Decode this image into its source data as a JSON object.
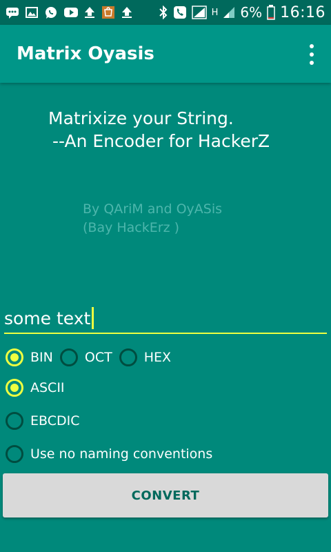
{
  "status_bar": {
    "battery": "6%",
    "time": "16:16",
    "network_label": "H"
  },
  "app_bar": {
    "title": "Matrix Oyasis"
  },
  "heading": {
    "line1": "Matrixize your String.",
    "line2": "--An Encoder for HackerZ"
  },
  "credits": {
    "line1": "By QAriM and OyASis",
    "line2": "(Bay HackErz )"
  },
  "input": {
    "value": "some text"
  },
  "base_options": [
    {
      "label": "BIN",
      "checked": true
    },
    {
      "label": "OCT",
      "checked": false
    },
    {
      "label": "HEX",
      "checked": false
    }
  ],
  "encoding_options": [
    {
      "label": "ASCII",
      "checked": true
    },
    {
      "label": "EBCDIC",
      "checked": false
    },
    {
      "label": "Use no naming conventions",
      "checked": false
    }
  ],
  "convert_button": {
    "label": "CONVERT"
  },
  "colors": {
    "background": "#00897B",
    "app_bar": "#009688",
    "status_bar": "#00695C",
    "accent": "#EEFF41",
    "button": "#D9D9D9"
  }
}
